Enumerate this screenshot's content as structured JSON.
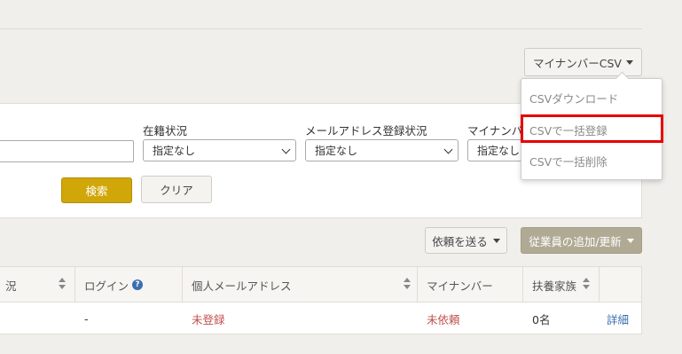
{
  "toolbar": {
    "mynumber_csv_label": "マイナンバーCSV"
  },
  "dropdown": {
    "items": [
      {
        "label": "CSVダウンロード"
      },
      {
        "label": "CSVで一括登録"
      },
      {
        "label": "CSVで一括削除"
      }
    ],
    "highlight_color": "#e60000"
  },
  "search": {
    "fields": [
      {
        "label": "在籍状況",
        "value": "指定なし"
      },
      {
        "label": "メールアドレス登録状況",
        "value": "指定なし"
      },
      {
        "label": "マイナンバ",
        "value": "指定なし"
      }
    ],
    "search_label": "検索",
    "clear_label": "クリア"
  },
  "actions": {
    "request_label": "依頼を送る",
    "add_label": "従業員の追加/更新"
  },
  "table": {
    "headers": [
      "況",
      "ログイン",
      "個人メールアドレス",
      "マイナンバー",
      "扶養家族",
      ""
    ],
    "row": {
      "login": "-",
      "email": "未登録",
      "mynumber": "未依頼",
      "dependents": "0名",
      "detail": "詳細"
    }
  },
  "colors": {
    "accent_gold": "#d1a609",
    "add_button": "#b0aa94",
    "status_red": "#c0504d",
    "link_blue": "#3a6fb0"
  }
}
